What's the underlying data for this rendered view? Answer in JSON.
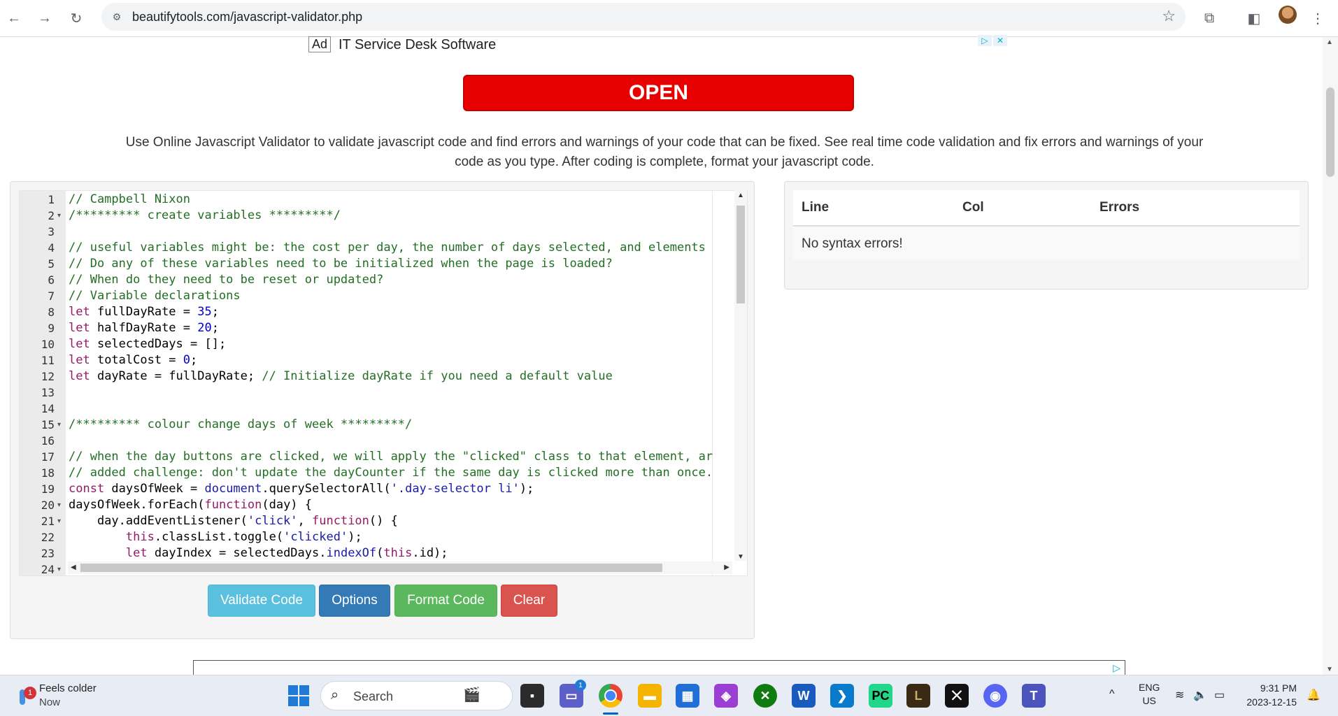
{
  "browser": {
    "url": "beautifytools.com/javascript-validator.php",
    "back_icon": "←",
    "forward_icon": "→",
    "reload_icon": "↻",
    "site_info_icon": "⚙",
    "bookmark_icon": "☆",
    "extensions_icon": "⧉",
    "sidepanel_icon": "◧",
    "menu_icon": "⋮"
  },
  "ad": {
    "badge": "Ad",
    "title": "IT Service Desk Software",
    "choices_icon": "▷",
    "close_icon": "✕",
    "button_label": "OPEN"
  },
  "intro": "Use Online Javascript Validator to validate javascript code and find errors and warnings of your code that can be fixed. See real time code validation and fix errors and warnings of your code as you type. After coding is complete, format your javascript code.",
  "editor": {
    "line_numbers": [
      "1",
      "2",
      "3",
      "4",
      "5",
      "6",
      "7",
      "8",
      "9",
      "10",
      "11",
      "12",
      "13",
      "14",
      "15",
      "16",
      "17",
      "18",
      "19",
      "20",
      "21",
      "22",
      "23",
      "24"
    ],
    "fold_lines": [
      "2",
      "15",
      "20",
      "21",
      "24"
    ],
    "lines": [
      [
        {
          "t": "// Campbell Nixon",
          "c": "comment"
        }
      ],
      [
        {
          "t": "/********* create variables *********/",
          "c": "comment"
        }
      ],
      [],
      [
        {
          "t": "// useful variables might be: the cost per day, the number of days selected, and elements",
          "c": "comment"
        }
      ],
      [
        {
          "t": "// Do any of these variables need to be initialized when the page is loaded?",
          "c": "comment"
        }
      ],
      [
        {
          "t": "// When do they need to be reset or updated?",
          "c": "comment"
        }
      ],
      [
        {
          "t": "// Variable declarations",
          "c": "comment"
        }
      ],
      [
        {
          "t": "let",
          "c": "kw"
        },
        {
          "t": " fullDayRate = ",
          "c": ""
        },
        {
          "t": "35",
          "c": "num"
        },
        {
          "t": ";",
          "c": ""
        }
      ],
      [
        {
          "t": "let",
          "c": "kw"
        },
        {
          "t": " halfDayRate = ",
          "c": ""
        },
        {
          "t": "20",
          "c": "num"
        },
        {
          "t": ";",
          "c": ""
        }
      ],
      [
        {
          "t": "let",
          "c": "kw"
        },
        {
          "t": " selectedDays = [];",
          "c": ""
        }
      ],
      [
        {
          "t": "let",
          "c": "kw"
        },
        {
          "t": " totalCost = ",
          "c": ""
        },
        {
          "t": "0",
          "c": "num"
        },
        {
          "t": ";",
          "c": ""
        }
      ],
      [
        {
          "t": "let",
          "c": "kw"
        },
        {
          "t": " dayRate = fullDayRate; ",
          "c": ""
        },
        {
          "t": "// Initialize dayRate if you need a default value",
          "c": "comment"
        }
      ],
      [],
      [],
      [
        {
          "t": "/********* colour change days of week *********/",
          "c": "comment"
        }
      ],
      [],
      [
        {
          "t": "// when the day buttons are clicked, we will apply the \"clicked\" class to that element, ar",
          "c": "comment"
        }
      ],
      [
        {
          "t": "// added challenge: don't update the dayCounter if the same day is clicked more than once.",
          "c": "comment"
        }
      ],
      [
        {
          "t": "const",
          "c": "kw"
        },
        {
          "t": " daysOfWeek = ",
          "c": ""
        },
        {
          "t": "document",
          "c": "builtin"
        },
        {
          "t": ".querySelectorAll(",
          "c": ""
        },
        {
          "t": "'.day-selector li'",
          "c": "str"
        },
        {
          "t": ");",
          "c": ""
        }
      ],
      [
        {
          "t": "daysOfWeek.forEach(",
          "c": ""
        },
        {
          "t": "function",
          "c": "kw"
        },
        {
          "t": "(day) {",
          "c": ""
        }
      ],
      [
        {
          "t": "    day.addEventListener(",
          "c": ""
        },
        {
          "t": "'click'",
          "c": "str"
        },
        {
          "t": ", ",
          "c": ""
        },
        {
          "t": "function",
          "c": "kw"
        },
        {
          "t": "() {",
          "c": ""
        }
      ],
      [
        {
          "t": "        ",
          "c": ""
        },
        {
          "t": "this",
          "c": "kw"
        },
        {
          "t": ".classList.toggle(",
          "c": ""
        },
        {
          "t": "'clicked'",
          "c": "str"
        },
        {
          "t": ");",
          "c": ""
        }
      ],
      [
        {
          "t": "        ",
          "c": ""
        },
        {
          "t": "let",
          "c": "kw"
        },
        {
          "t": " dayIndex = selectedDays.",
          "c": ""
        },
        {
          "t": "indexOf",
          "c": "builtin"
        },
        {
          "t": "(",
          "c": ""
        },
        {
          "t": "this",
          "c": "kw"
        },
        {
          "t": ".id);",
          "c": ""
        }
      ],
      []
    ]
  },
  "buttons": {
    "validate": "Validate Code",
    "options": "Options",
    "format": "Format Code",
    "clear": "Clear"
  },
  "errors": {
    "columns": [
      "Line",
      "Col",
      "Errors"
    ],
    "message": "No syntax errors!"
  },
  "taskbar": {
    "weather_badge": "1",
    "weather_line1": "Feels colder",
    "weather_line2": "Now",
    "search_placeholder": "Search",
    "teams_badge": "1",
    "lang_line1": "ENG",
    "lang_line2": "US",
    "time": "9:31 PM",
    "date": "2023-12-15"
  },
  "colors": {
    "validate": "#5bc0de",
    "options": "#337ab7",
    "format": "#5cb85c",
    "clear": "#d9534f",
    "ad_button": "#e60000"
  }
}
